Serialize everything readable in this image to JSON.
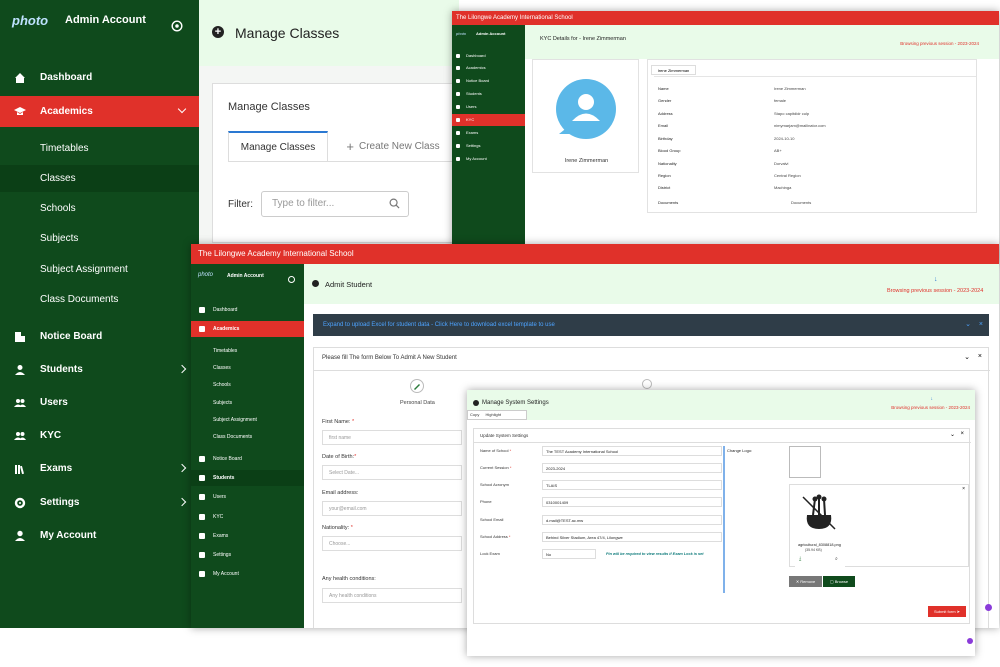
{
  "main": {
    "brand": "photo",
    "account": "Admin Account",
    "nav": [
      {
        "label": "Dashboard"
      },
      {
        "label": "Academics"
      },
      {
        "label": "Notice Board"
      },
      {
        "label": "Students"
      },
      {
        "label": "Users"
      },
      {
        "label": "KYC"
      },
      {
        "label": "Exams"
      },
      {
        "label": "Settings"
      },
      {
        "label": "My Account"
      }
    ],
    "academics_sub": [
      "Timetables",
      "Classes",
      "Schools",
      "Subjects",
      "Subject Assignment",
      "Class Documents"
    ],
    "page_title": "Manage Classes",
    "card_title": "Manage Classes",
    "tabs": [
      "Manage Classes",
      "Create New Class"
    ],
    "filter_label": "Filter:",
    "filter_placeholder": "Type to filter..."
  },
  "kyc": {
    "school": "The Lilongwe Academy International School",
    "brand": "photo",
    "account": "Admin Account",
    "nav": [
      "Dashboard",
      "Academics",
      "Notice Board",
      "Students",
      "Users",
      "KYC",
      "Exams",
      "Settings",
      "My Account"
    ],
    "title": "KYC Details for - Irene Zimmerman",
    "browse": "Browsing previous session - 2023-2024",
    "name": "Irene Zimmerman",
    "tab": "Irene Zimmerman",
    "rows": [
      {
        "k": "Name",
        "v": "Irene Zimmerman"
      },
      {
        "k": "Gender",
        "v": "female"
      },
      {
        "k": "Address",
        "v": "Stapo capitdidr culp"
      },
      {
        "k": "Email",
        "v": "nimymarjam@mailinator.com"
      },
      {
        "k": "Birthday",
        "v": "2024-10-10"
      },
      {
        "k": "Blood Group",
        "v": "AB+"
      },
      {
        "k": "Nationality",
        "v": "Dorvalvi"
      },
      {
        "k": "Region",
        "v": "Central Region"
      },
      {
        "k": "District",
        "v": "Machinga"
      },
      {
        "k": "Documents",
        "v": "Documents"
      }
    ]
  },
  "admit": {
    "school": "The Lilongwe Academy International School",
    "brand": "photo",
    "account": "Admin Account",
    "nav": [
      "Dashboard",
      "Academics",
      "Notice Board",
      "Students",
      "Users",
      "KYC",
      "Exams",
      "Settings",
      "My Account"
    ],
    "sub": [
      "Timetables",
      "Classes",
      "Schools",
      "Subjects",
      "Subject Assignment",
      "Class Documents"
    ],
    "title": "Admit Student",
    "browse": "Browsing previous session - 2023-2024",
    "excel_text": "Expand to upload Excel for student data - ",
    "excel_link": "Click Here to download excel template to use",
    "form_title": "Please fill The form Below To Admit A New Student",
    "step1": "Personal Data",
    "fields": [
      {
        "label": "First Name:",
        "req": "*",
        "placeholder": "first name"
      },
      {
        "label": "Date of Birth:",
        "req": "*",
        "placeholder": "Select Date..."
      },
      {
        "label": "Email address:",
        "req": "",
        "placeholder": "your@email.com"
      },
      {
        "label": "Nationality:",
        "req": "*",
        "placeholder": "Choose..."
      },
      {
        "label": "Any health conditions:",
        "req": "",
        "placeholder": "Any health conditions"
      }
    ]
  },
  "settings": {
    "title": "Manage System Settings",
    "browse": "Browsing previous session - 2023-2024",
    "toolbar": [
      "Copy",
      "Highlight"
    ],
    "card_title": "Update System Settings",
    "fields": [
      {
        "label": "Name of School",
        "req": "*",
        "value": "The TEST Academy International School"
      },
      {
        "label": "Current Session",
        "req": "*",
        "value": "2023-2024"
      },
      {
        "label": "School Acronym",
        "req": "",
        "value": "TLAIS"
      },
      {
        "label": "Phone",
        "req": "",
        "value": "0310001409"
      },
      {
        "label": "School Email",
        "req": "",
        "value": "d.mail@TEST.ac.mw"
      },
      {
        "label": "School Address",
        "req": "*",
        "value": "Behind Silver Stadium, Area 47/4, Lilongwe"
      },
      {
        "label": "Lock Exam",
        "req": "",
        "value": "No"
      }
    ],
    "lock_note": "Pin will be required to view results if Exam Lock is set",
    "logo_label": "Change Logo:",
    "file_name": "agricultural_8308818.png",
    "file_size": "(35.94 KB)",
    "remove": "Remove",
    "browse_btn": "Browse",
    "submit": "Submit form"
  },
  "colors": {
    "sidebar": "#0f4a1c",
    "accent_red": "#e0312a",
    "header_green": "#e9fbe9",
    "link_blue": "#2a78d2"
  }
}
